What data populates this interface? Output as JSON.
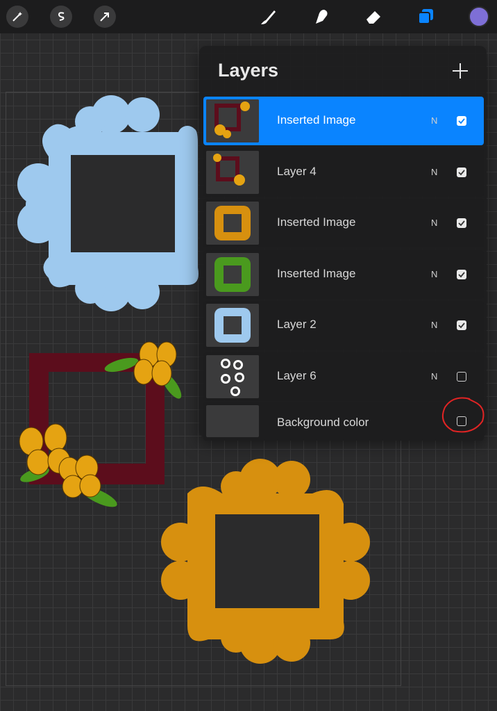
{
  "toolbar": {
    "left_tools": [
      "magic-wand-icon",
      "selection-s-icon",
      "transform-arrow-icon"
    ],
    "right_tools": [
      "brush-icon",
      "smudge-icon",
      "eraser-icon",
      "layers-icon"
    ],
    "current_color": "#7e6fd6",
    "accent": "#0a84ff"
  },
  "layers_panel": {
    "title": "Layers",
    "add_icon": "plus-icon",
    "layers": [
      {
        "name": "Inserted Image",
        "blend": "N",
        "visible": true,
        "active": true,
        "thumb": "red-frame-flowers"
      },
      {
        "name": "Layer 4",
        "blend": "N",
        "visible": true,
        "active": false,
        "thumb": "red-frame-flowers-2"
      },
      {
        "name": "Inserted Image",
        "blend": "N",
        "visible": true,
        "active": false,
        "thumb": "orange-ornate-frame"
      },
      {
        "name": "Inserted Image",
        "blend": "N",
        "visible": true,
        "active": false,
        "thumb": "green-ornate-frame"
      },
      {
        "name": "Layer 2",
        "blend": "N",
        "visible": true,
        "active": false,
        "thumb": "blue-ornate-frame"
      },
      {
        "name": "Layer 6",
        "blend": "N",
        "visible": false,
        "active": false,
        "thumb": "white-blobs"
      }
    ],
    "background": {
      "name": "Background color",
      "visible": false
    }
  },
  "canvas_colors": {
    "blue_frame": "#9ec9ee",
    "red_frame": "#5c0d1c",
    "orange_frame": "#d7900f",
    "flower": "#e5a312",
    "leaf": "#4a9a1e"
  }
}
